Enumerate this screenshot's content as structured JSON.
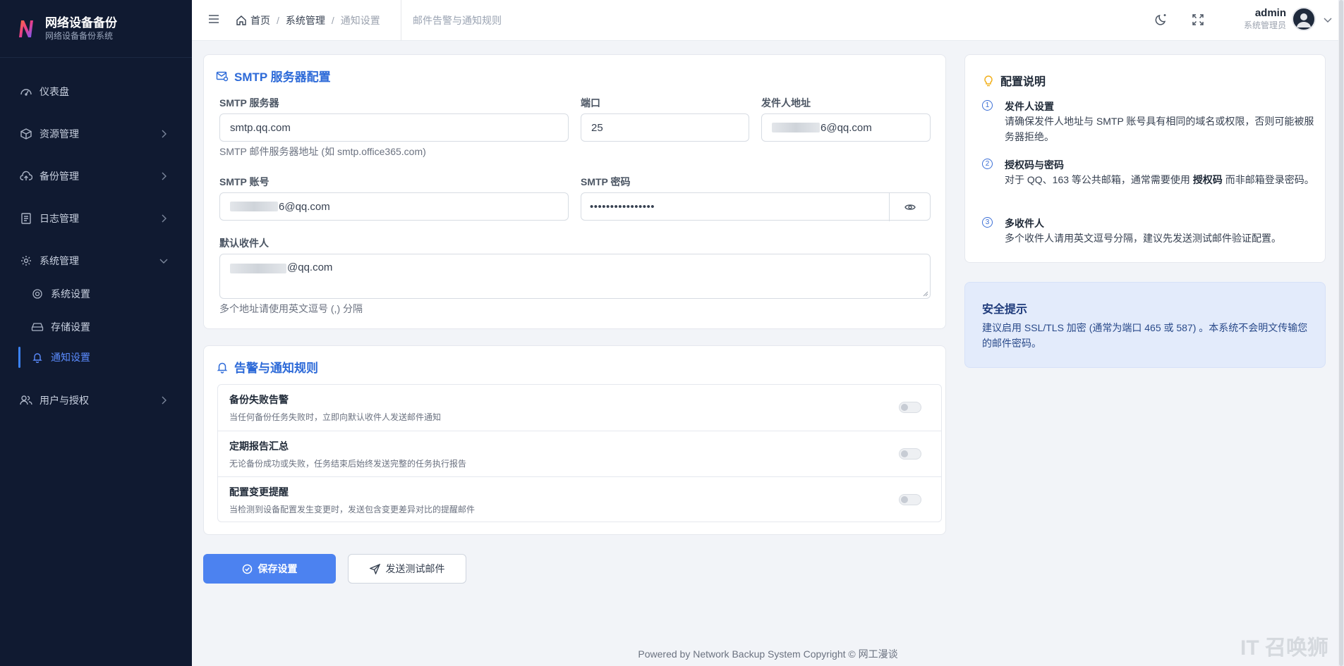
{
  "brand": {
    "title": "网络设备备份",
    "subtitle": "网络设备备份系统"
  },
  "sidebar": {
    "items": [
      {
        "label": "仪表盘",
        "icon": "dashboard-icon"
      },
      {
        "label": "资源管理",
        "icon": "cube-icon"
      },
      {
        "label": "备份管理",
        "icon": "cloud-upload-icon"
      },
      {
        "label": "日志管理",
        "icon": "document-icon"
      },
      {
        "label": "系统管理",
        "icon": "gear-icon"
      },
      {
        "label": "系统设置",
        "icon": "gear-icon"
      },
      {
        "label": "存储设置",
        "icon": "storage-icon"
      },
      {
        "label": "通知设置",
        "icon": "bell-icon"
      },
      {
        "label": "用户与授权",
        "icon": "users-icon"
      }
    ]
  },
  "header": {
    "breadcrumb": [
      "首页",
      "系统管理",
      "通知设置"
    ],
    "tab_title": "邮件告警与通知规则",
    "user": {
      "name": "admin",
      "role": "系统管理员"
    }
  },
  "smtp": {
    "title": "SMTP 服务器配置",
    "server_label": "SMTP 服务器",
    "server_value": "smtp.qq.com",
    "server_help": "SMTP 邮件服务器地址 (如 smtp.office365.com)",
    "port_label": "端口",
    "port_value": "25",
    "sender_label": "发件人地址",
    "sender_value": "6@qq.com",
    "account_label": "SMTP 账号",
    "account_value": "6@qq.com",
    "password_label": "SMTP 密码",
    "password_value": "••••••••••••••••",
    "recipient_label": "默认收件人",
    "recipient_value": "@qq.com",
    "recipient_help": "多个地址请使用英文逗号 (,) 分隔"
  },
  "rules": {
    "title": "告警与通知规则",
    "items": [
      {
        "title": "备份失败告警",
        "desc": "当任何备份任务失败时，立即向默认收件人发送邮件通知",
        "enabled": false
      },
      {
        "title": "定期报告汇总",
        "desc": "无论备份成功或失败，任务结束后始终发送完整的任务执行报告",
        "enabled": false
      },
      {
        "title": "配置变更提醒",
        "desc": "当检测到设备配置发生变更时，发送包含变更差异对比的提醒邮件",
        "enabled": false
      }
    ]
  },
  "actions": {
    "save": "保存设置",
    "test": "发送测试邮件"
  },
  "tips": {
    "title": "配置说明",
    "items": [
      {
        "num": "1",
        "title": "发件人设置",
        "text": "请确保发件人地址与 SMTP 账号具有相同的域名或权限，否则可能被服务器拒绝。"
      },
      {
        "num": "2",
        "title": "授权码与密码",
        "text_before": "对于 QQ、163 等公共邮箱，通常需要使用 ",
        "text_bold": "授权码",
        "text_after": " 而非邮箱登录密码。"
      },
      {
        "num": "3",
        "title": "多收件人",
        "text": "多个收件人请用英文逗号分隔，建议先发送测试邮件验证配置。"
      }
    ]
  },
  "security": {
    "title": "安全提示",
    "text": "建议启用 SSL/TLS 加密 (通常为端口 465 或 587) 。本系统不会明文传输您的邮件密码。"
  },
  "footer": "Powered by Network Backup System Copyright © 网工漫谈",
  "watermark": "IT 召唤狮",
  "colors": {
    "sidebar_bg": "#101a31",
    "accent": "#4c82f0",
    "title_blue": "#2d6ad8",
    "security_bg": "#e3ebfb"
  }
}
